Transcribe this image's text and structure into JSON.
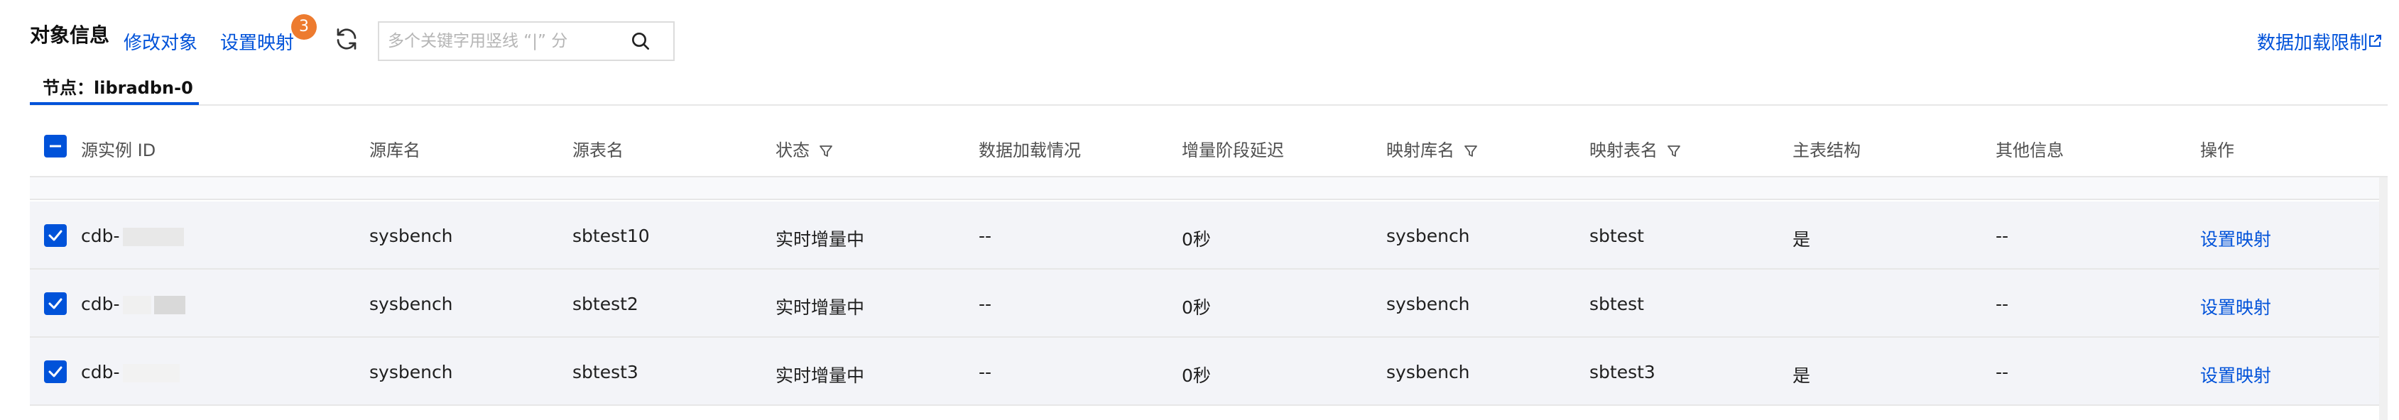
{
  "header": {
    "title": "对象信息",
    "edit_label": "修改对象",
    "set_mapping_label": "设置映射",
    "badge_count": "3",
    "search_placeholder": "多个关键字用竖线 “|” 分",
    "right_link": "数据加载限制"
  },
  "tabs": [
    {
      "label": "节点：libradbn-0",
      "active": true
    }
  ],
  "table": {
    "columns": [
      "源实例 ID",
      "源库名",
      "源表名",
      "状态",
      "数据加载情况",
      "增量阶段延迟",
      "映射库名",
      "映射表名",
      "主表结构",
      "其他信息",
      "操作"
    ],
    "filterable_columns": [
      "状态",
      "映射库名",
      "映射表名"
    ],
    "rows": [
      {
        "instance": "cdb-",
        "source_db": "sysbench",
        "source_table": "sbtest10",
        "status": "实时增量中",
        "load": "--",
        "delay": "0秒",
        "map_db": "sysbench",
        "map_table": "sbtest",
        "main_struct": "是",
        "other": "--",
        "action": "设置映射",
        "checked": true
      },
      {
        "instance": "cdb-",
        "source_db": "sysbench",
        "source_table": "sbtest2",
        "status": "实时增量中",
        "load": "--",
        "delay": "0秒",
        "map_db": "sysbench",
        "map_table": "sbtest",
        "main_struct": "",
        "other": "--",
        "action": "设置映射",
        "checked": true
      },
      {
        "instance": "cdb-",
        "source_db": "sysbench",
        "source_table": "sbtest3",
        "status": "实时增量中",
        "load": "--",
        "delay": "0秒",
        "map_db": "sysbench",
        "map_table": "sbtest3",
        "main_struct": "是",
        "other": "--",
        "action": "设置映射",
        "checked": true
      }
    ]
  },
  "colors": {
    "accent": "#0052d9",
    "badge": "#ed7b2f",
    "row_bg": "#f3f4f8"
  },
  "icons": [
    "refresh-icon",
    "search-icon",
    "external-link-icon",
    "filter-icon",
    "checkbox-checked-icon",
    "checkbox-indeterminate-icon"
  ]
}
